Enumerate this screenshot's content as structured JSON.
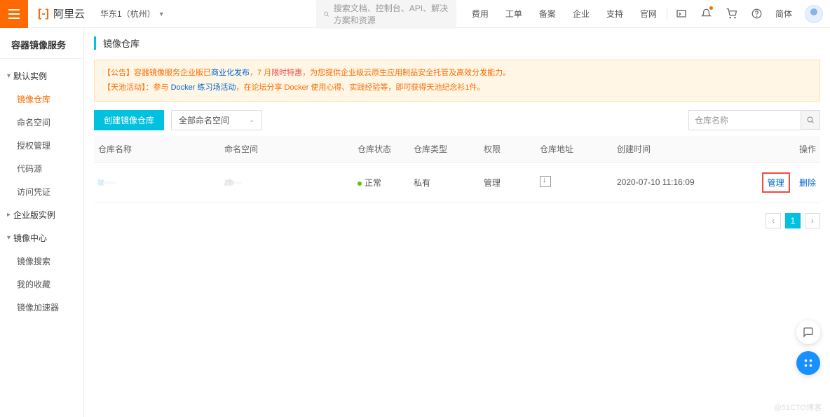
{
  "header": {
    "logo_text": "阿里云",
    "region": "华东1（杭州）",
    "search_placeholder": "搜索文档、控制台、API、解决方案和资源",
    "nav": [
      "费用",
      "工单",
      "备案",
      "企业",
      "支持",
      "官网"
    ],
    "lang": "简体"
  },
  "sidebar": {
    "title": "容器镜像服务",
    "groups": [
      {
        "label": "默认实例",
        "items": [
          "镜像仓库",
          "命名空间",
          "授权管理",
          "代码源",
          "访问凭证"
        ]
      },
      {
        "label": "企业版实例",
        "items": []
      },
      {
        "label": "镜像中心",
        "items": [
          "镜像搜索",
          "我的收藏",
          "镜像加速器"
        ]
      }
    ],
    "active_item": "镜像仓库"
  },
  "main": {
    "page_title": "镜像仓库",
    "notice": {
      "line1_prefix": "【公告】容器镜像服务企业版已",
      "line1_link1": "商业化发布",
      "line1_mid": "，7 月",
      "line1_red": "限时特惠",
      "line1_tail": "，为您提供企业级云原生应用制品安全托管及高效分发能力。",
      "line2_prefix": "【天池活动】：参与 ",
      "line2_link1": "Docker 练习场活动",
      "line2_tail": "，在论坛分享 Docker 使用心得、实践经验等，即可获得天池纪念衫1件。"
    },
    "btn_create": "创建镜像仓库",
    "ns_select": "全部命名空间",
    "search_placeholder": "仓库名称",
    "columns": [
      "仓库名称",
      "命名空间",
      "仓库状态",
      "仓库类型",
      "权限",
      "仓库地址",
      "创建时间",
      "操作"
    ],
    "rows": [
      {
        "name": "lz····",
        "namespace": "zb···",
        "status": "正常",
        "type": "私有",
        "perm": "管理",
        "created": "2020-07-10 11:16:09",
        "op_manage": "管理",
        "op_delete": "删除"
      }
    ],
    "pagination_current": "1"
  },
  "watermark": "@51CTO博客"
}
